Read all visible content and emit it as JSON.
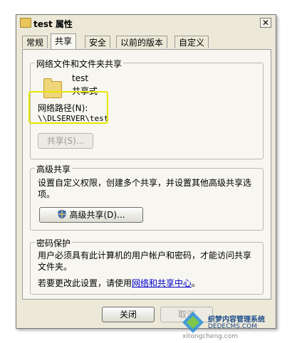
{
  "window": {
    "title": "test 属性",
    "close_glyph": "✕"
  },
  "tabs": [
    {
      "label": "常规"
    },
    {
      "label": "共享",
      "active": true
    },
    {
      "label": "安全"
    },
    {
      "label": "以前的版本"
    },
    {
      "label": "自定义"
    }
  ],
  "share_group": {
    "title": "网络文件和文件夹共享",
    "folder_name": "test",
    "folder_status": "共享式",
    "path_label": "网络路径(N):",
    "path_value": "\\\\DLSERVER\\test",
    "share_button": "共享(S)..."
  },
  "advanced_group": {
    "title": "高级共享",
    "description": "设置自定义权限，创建多个共享，并设置其他高级共享选项。",
    "button": "高级共享(D)..."
  },
  "password_group": {
    "title": "密码保护",
    "description": "用户必须具有此计算机的用户帐户和密码，才能访问共享文件夹。",
    "change_prefix": "若要更改此设置，请使用",
    "link": "网络和共享中心",
    "change_suffix": "。"
  },
  "footer": {
    "close_button": "关闭",
    "cancel_button": "取消"
  },
  "watermark": {
    "text": "织梦内容管理系统",
    "url": "DEDECMS.COM",
    "sub": "xitongcheng.com"
  },
  "colors": {
    "highlight": "#e6e600",
    "link": "#0000cc",
    "dialog_bg": "#ece9d8"
  }
}
